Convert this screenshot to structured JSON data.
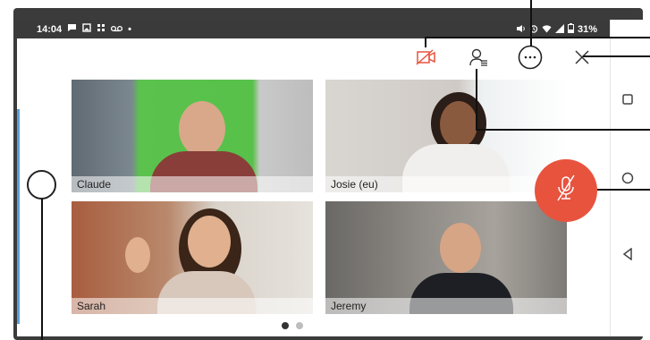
{
  "status": {
    "time": "14:04",
    "battery": "31%",
    "left_icons": [
      "chat-icon",
      "image-icon",
      "slack-icon",
      "voicemail-icon"
    ],
    "right_icons": [
      "nfc-icon",
      "alarm-icon",
      "wifi-icon",
      "signal-icon",
      "battery-icon"
    ]
  },
  "toolbar": {
    "icons": [
      "camera-off-icon",
      "participants-icon",
      "more-icon",
      "close-icon"
    ],
    "camera_color": "#e8533e"
  },
  "participants": [
    {
      "name": "Claude"
    },
    {
      "name": "Josie (eu)"
    },
    {
      "name": "Sarah"
    },
    {
      "name": "Jeremy"
    }
  ],
  "mic": {
    "state": "muted",
    "color": "#e8533e"
  },
  "pager": {
    "pages": 2,
    "current": 1
  },
  "nav": {
    "icons": [
      "recent-apps-icon",
      "home-icon",
      "back-icon"
    ]
  }
}
